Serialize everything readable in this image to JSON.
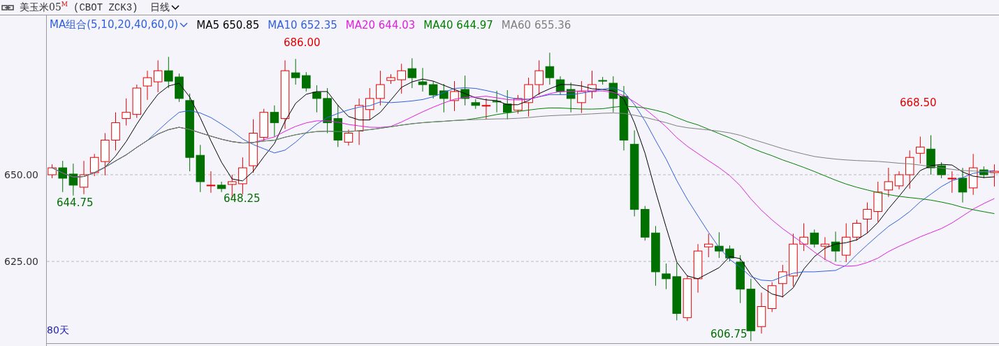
{
  "header": {
    "symbol": "美玉米05",
    "symbol_sup": "M",
    "code": "(CBOT  ZCK3)",
    "period": "日线"
  },
  "ma_legend": {
    "group": "MA组合(5,10,20,40,60,0)",
    "items": [
      {
        "label": "MA5 650.85",
        "color": "#000000"
      },
      {
        "label": "MA10 652.35",
        "color": "#3060e0"
      },
      {
        "label": "MA20 644.03",
        "color": "#e020e0"
      },
      {
        "label": "MA40 644.97",
        "color": "#008000"
      },
      {
        "label": "MA60 655.36",
        "color": "#808080"
      }
    ]
  },
  "y_axis": {
    "ticks": [
      "650.00",
      "625.00"
    ]
  },
  "annotations": [
    {
      "label": "686.00",
      "kind": "high"
    },
    {
      "label": "668.50",
      "kind": "high"
    },
    {
      "label": "644.75",
      "kind": "low"
    },
    {
      "label": "648.25",
      "kind": "low"
    },
    {
      "label": "606.75",
      "kind": "low"
    }
  ],
  "days_label": "80天"
}
